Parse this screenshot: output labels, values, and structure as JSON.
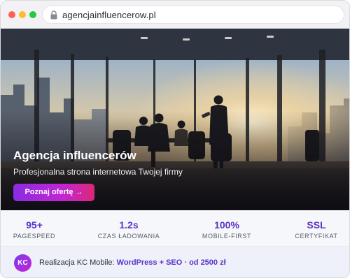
{
  "browser": {
    "url": "agencjainfluencerow.pl"
  },
  "hero": {
    "title": "Agencja influencerów",
    "subtitle": "Profesjonalna strona internetowa Twojej firmy",
    "cta_label": "Poznaj ofertę →"
  },
  "stats": [
    {
      "value": "95+",
      "label": "PAGESPEED"
    },
    {
      "value": "1.2s",
      "label": "CZAS ŁADOWANIA"
    },
    {
      "value": "100%",
      "label": "MOBILE-FIRST"
    },
    {
      "value": "SSL",
      "label": "CERTYFIKAT"
    }
  ],
  "footer": {
    "avatar_initials": "KC",
    "prefix": "Realizacja KC Mobile: ",
    "highlight": "WordPress + SEO · od 2500 zł"
  },
  "colors": {
    "accent": "#5b33c9",
    "cta_gradient_start": "#8a2be2",
    "cta_gradient_end": "#db2777"
  }
}
